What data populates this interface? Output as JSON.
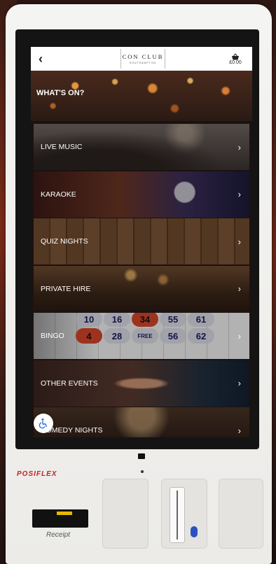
{
  "header": {
    "back_icon": "chevron-left-icon",
    "logo_main": "CON CLUB",
    "logo_sub": "SOUTHAMPTON",
    "basket_icon": "basket-icon",
    "basket_total": "£0.00"
  },
  "banner": {
    "title": "WHAT'S ON?"
  },
  "events": [
    {
      "label": "LIVE MUSIC"
    },
    {
      "label": "KARAOKE"
    },
    {
      "label": "QUIZ NIGHTS"
    },
    {
      "label": "PRIVATE HIRE"
    },
    {
      "label": "BINGO"
    },
    {
      "label": "OTHER EVENTS"
    },
    {
      "label": "COMEDY NIGHTS"
    }
  ],
  "bingo_card_numbers": [
    "10",
    "16",
    "34",
    "55",
    "61",
    "4",
    "28",
    "FREE",
    "56",
    "62"
  ],
  "kiosk": {
    "brand": "POSIFLEX",
    "receipt_label": "Receipt",
    "accessibility_icon": "wheelchair-icon"
  }
}
